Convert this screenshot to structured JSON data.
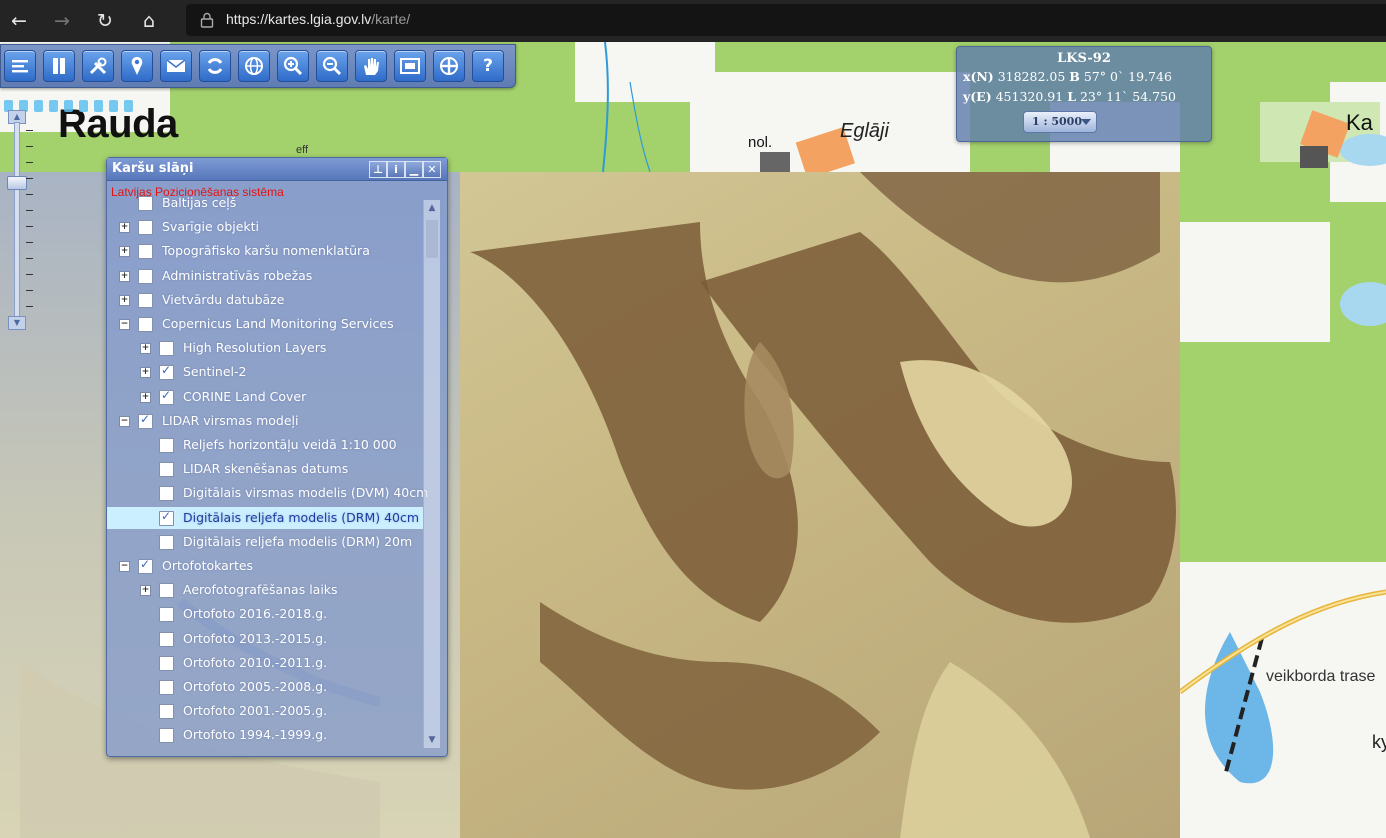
{
  "browser": {
    "url_host": "https://kartes.lgia.gov.lv",
    "url_path": "/karte/",
    "nav": {
      "back": "←",
      "forward": "→",
      "reload": "↻",
      "home": "⌂"
    }
  },
  "map": {
    "labels": {
      "town": "Rauda",
      "place": "Eglāji",
      "nol": "nol.",
      "ka": "Ka",
      "trase": "veikborda trase",
      "ky": "ky",
      "stray": "eff"
    }
  },
  "toolbar": {
    "tools": [
      {
        "icon": "list-icon"
      },
      {
        "icon": "layers-icon"
      },
      {
        "icon": "tools-icon"
      },
      {
        "icon": "pin-icon"
      },
      {
        "icon": "envelope-icon"
      },
      {
        "icon": "refresh-icon"
      },
      {
        "icon": "globe-icon"
      },
      {
        "icon": "zoom-in-icon"
      },
      {
        "icon": "zoom-out-icon"
      },
      {
        "icon": "hand-icon"
      },
      {
        "icon": "full-extent-icon"
      },
      {
        "icon": "crosshair-icon"
      },
      {
        "icon": "help-icon",
        "text": "?"
      }
    ]
  },
  "coordinates": {
    "system": "LKS-92",
    "x_label": "x(N)",
    "x_value": "318282.05",
    "b_label": "B",
    "b_value": "57° 0` 19.746",
    "y_label": "y(E)",
    "y_value": "451320.91",
    "l_label": "L",
    "l_value": "23° 11` 54.750",
    "scale": "1 : 5000"
  },
  "layers_panel": {
    "title": "Karšu slāņi",
    "subtitle": "Latvijas Pozicionēšanas sistēma",
    "buttons": {
      "pin": "⊥",
      "info": "i",
      "minimize": "▁",
      "close": "✕"
    },
    "items": [
      {
        "label": "Baltijas ceļš",
        "level": 0,
        "expander": "",
        "checked": false
      },
      {
        "label": "Svarīgie objekti",
        "level": 0,
        "expander": "+",
        "checked": false
      },
      {
        "label": "Topogrāfisko karšu nomenklatūra",
        "level": 0,
        "expander": "+",
        "checked": false
      },
      {
        "label": "Administratīvās robežas",
        "level": 0,
        "expander": "+",
        "checked": false
      },
      {
        "label": "Vietvārdu datubāze",
        "level": 0,
        "expander": "+",
        "checked": false
      },
      {
        "label": "Copernicus Land Monitoring Services",
        "level": 0,
        "expander": "−",
        "checked": false
      },
      {
        "label": "High Resolution Layers",
        "level": 1,
        "expander": "+",
        "checked": false
      },
      {
        "label": "Sentinel-2",
        "level": 1,
        "expander": "+",
        "checked": true
      },
      {
        "label": "CORINE Land Cover",
        "level": 1,
        "expander": "+",
        "checked": true
      },
      {
        "label": "LIDAR virsmas modeļi",
        "level": 0,
        "expander": "−",
        "checked": true
      },
      {
        "label": "Reljefs horizontāļu veidā 1:10 000",
        "level": 1,
        "expander": "",
        "checked": false
      },
      {
        "label": "LIDAR skenēšanas datums",
        "level": 1,
        "expander": "",
        "checked": false
      },
      {
        "label": "Digitālais virsmas modelis (DVM) 40cm",
        "level": 1,
        "expander": "",
        "checked": false
      },
      {
        "label": "Digitālais reljefa modelis (DRM) 40cm",
        "level": 1,
        "expander": "",
        "checked": true,
        "highlight": true
      },
      {
        "label": "Digitālais reljefa modelis (DRM) 20m",
        "level": 1,
        "expander": "",
        "checked": false
      },
      {
        "label": "Ortofotokartes",
        "level": 0,
        "expander": "−",
        "checked": true
      },
      {
        "label": "Aerofotografēšanas laiks",
        "level": 1,
        "expander": "+",
        "checked": false
      },
      {
        "label": "Ortofoto 2016.-2018.g.",
        "level": 1,
        "expander": "",
        "checked": false
      },
      {
        "label": "Ortofoto 2013.-2015.g.",
        "level": 1,
        "expander": "",
        "checked": false
      },
      {
        "label": "Ortofoto 2010.-2011.g.",
        "level": 1,
        "expander": "",
        "checked": false
      },
      {
        "label": "Ortofoto 2005.-2008.g.",
        "level": 1,
        "expander": "",
        "checked": false
      },
      {
        "label": "Ortofoto 2001.-2005.g.",
        "level": 1,
        "expander": "",
        "checked": false
      },
      {
        "label": "Ortofoto 1994.-1999.g.",
        "level": 1,
        "expander": "",
        "checked": false
      }
    ]
  }
}
